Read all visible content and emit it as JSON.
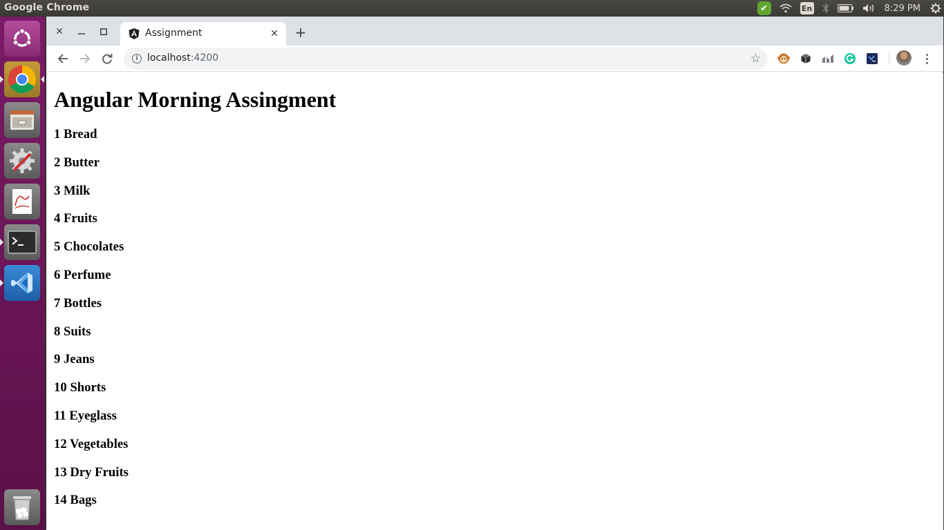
{
  "panel": {
    "app_title": "Google Chrome",
    "input_method": "En",
    "clock": "8:29 PM"
  },
  "launcher": {
    "items": [
      "ubuntu-dash",
      "chrome",
      "files",
      "system-settings",
      "document-viewer",
      "terminal",
      "vscode",
      "trash"
    ]
  },
  "browser": {
    "tab": {
      "title": "Assignment"
    },
    "address": {
      "host": "localhost",
      "port": ":4200"
    }
  },
  "page": {
    "heading": "Angular Morning Assingment",
    "items": [
      "1 Bread",
      "2 Butter",
      "3 Milk",
      "4 Fruits",
      "5 Chocolates",
      "6 Perfume",
      "7 Bottles",
      "8 Suits",
      "9 Jeans",
      "10 Shorts",
      "11 Eyeglass",
      "12 Vegetables",
      "13 Dry Fruits",
      "14 Bags"
    ]
  },
  "colors": {
    "launcher": "#6a1458",
    "tabstrip": "#dee1e6",
    "grammarly": "#15c39a"
  }
}
